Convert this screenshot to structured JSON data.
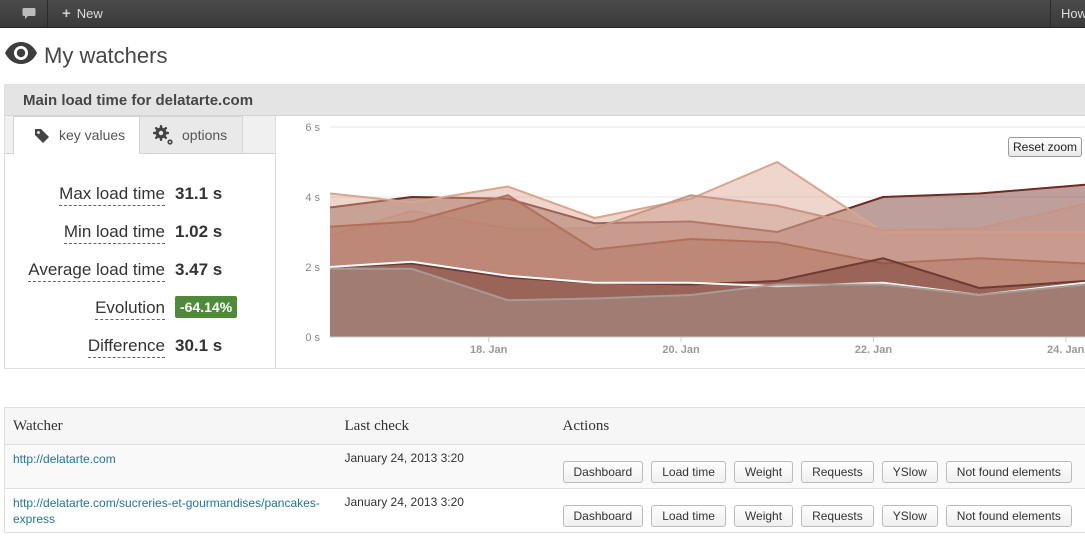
{
  "adminbar": {
    "new_label": "New",
    "right_label": "How"
  },
  "page": {
    "title": "My watchers"
  },
  "panel": {
    "title": "Main load time for delatarte.com",
    "tabs": [
      {
        "label": "key values",
        "icon": "tag-icon",
        "active": true
      },
      {
        "label": "options",
        "icon": "gear-icon",
        "active": false
      }
    ],
    "stats": [
      {
        "label": "Max load time",
        "value": "31.1 s"
      },
      {
        "label": "Min load time",
        "value": "1.02 s"
      },
      {
        "label": "Average load time",
        "value": "3.47 s"
      },
      {
        "label": "Evolution",
        "value": "-64.14%",
        "badge": true
      },
      {
        "label": "Difference",
        "value": "30.1 s"
      }
    ],
    "reset_zoom_label": "Reset zoom"
  },
  "chart_data": {
    "type": "area",
    "y_ticks": [
      "6 s",
      "4 s",
      "2 s",
      "0 s"
    ],
    "ylim": [
      0,
      6
    ],
    "x_ticks": [
      "18. Jan",
      "20. Jan",
      "22. Jan",
      "24. Jan"
    ],
    "x_tick_values": [
      18,
      20,
      22,
      24
    ],
    "xlim": [
      16.35,
      24.2
    ],
    "grid": true,
    "colors": [
      "#9b6a5e",
      "#b0705a",
      "#c89584",
      "#d9a58e",
      "#6e2b22",
      "#a99a95",
      "#8c7b77"
    ],
    "series": [
      {
        "x": [
          16.35,
          17.2,
          18.2,
          19.1,
          20.1,
          21.0,
          22.1,
          23.1,
          24.2
        ],
        "values": [
          3.7,
          4.0,
          3.95,
          3.25,
          3.3,
          3.0,
          4.0,
          4.1,
          4.35
        ],
        "color": "#6e2b22"
      },
      {
        "x": [
          16.35,
          17.2,
          18.2,
          19.1,
          20.1,
          21.0,
          22.1,
          23.1,
          24.2
        ],
        "values": [
          4.1,
          3.85,
          4.3,
          3.4,
          3.95,
          5.0,
          3.0,
          3.0,
          3.0
        ],
        "color": "#d9a58e"
      },
      {
        "x": [
          16.35,
          17.2,
          18.2,
          19.1,
          20.1,
          21.0,
          22.1,
          23.1,
          24.2
        ],
        "values": [
          2.9,
          3.6,
          3.1,
          3.1,
          4.05,
          3.75,
          3.05,
          3.1,
          3.8
        ],
        "color": "#c89584"
      },
      {
        "x": [
          16.35,
          17.2,
          18.2,
          19.1,
          20.1,
          21.0,
          22.1,
          23.1,
          24.2
        ],
        "values": [
          3.15,
          3.3,
          4.05,
          2.5,
          2.8,
          2.7,
          2.1,
          2.25,
          2.1
        ],
        "color": "#b0705a"
      },
      {
        "x": [
          16.35,
          17.2,
          18.2,
          19.1,
          20.1,
          21.0,
          22.1,
          23.1,
          24.2
        ],
        "values": [
          2.0,
          2.1,
          1.7,
          1.55,
          1.5,
          1.6,
          2.25,
          1.4,
          1.6
        ],
        "color": "#6e3a33"
      },
      {
        "x": [
          16.35,
          17.2,
          18.2,
          19.1,
          20.1,
          21.0,
          22.1,
          23.1,
          24.2
        ],
        "values": [
          2.0,
          2.15,
          1.75,
          1.55,
          1.55,
          1.45,
          1.55,
          1.2,
          1.55
        ],
        "color": "#ffffff"
      },
      {
        "x": [
          16.35,
          17.2,
          18.2,
          19.1,
          20.1,
          21.0,
          22.1,
          23.1,
          24.2
        ],
        "values": [
          1.95,
          1.95,
          1.05,
          1.1,
          1.2,
          1.5,
          1.5,
          1.2,
          1.5
        ],
        "color": "#a99a95"
      }
    ]
  },
  "table": {
    "headers": [
      "Watcher",
      "Last check",
      "Actions"
    ],
    "rows": [
      {
        "url": "http://delatarte.com",
        "last_check": "January 24, 2013 3:20"
      },
      {
        "url": "http://delatarte.com/sucreries-et-gourmandises/pancakes-express",
        "last_check": "January 24, 2013 3:20"
      }
    ],
    "actions": [
      "Dashboard",
      "Load time",
      "Weight",
      "Requests",
      "YSlow",
      "Not found elements"
    ]
  }
}
